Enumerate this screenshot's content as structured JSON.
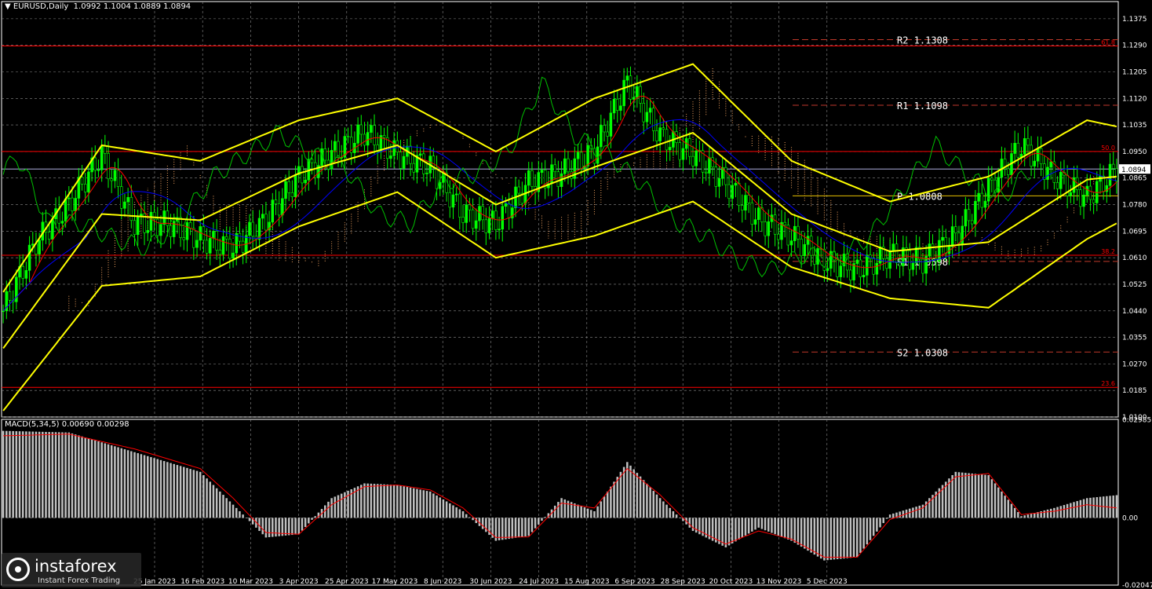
{
  "header": {
    "symbol": "EURUSD,Daily",
    "ohlc": "1.0992 1.1004 1.0889 1.0894"
  },
  "macd_header": {
    "label": "MACD(5,34,5)",
    "values": "0.00690 0.00298"
  },
  "logo": {
    "name": "instaforex",
    "tagline": "Instant Forex Trading"
  },
  "colors": {
    "background": "#000000",
    "grid": "#8c8c8c",
    "bull_candle": "#00ff00",
    "bear_candle": "#000000",
    "bollinger": "#ffff00",
    "tenkan": "#ff0000",
    "kijun": "#0000ff",
    "chikou": "#00c000",
    "kumo": "#f4a460",
    "pivot_lines": "#c0392b",
    "fib_lines": "#ff0000",
    "macd_hist": "#c0c0c0",
    "macd_signal": "#ff0000",
    "current_price": "#c8c8ff"
  },
  "chart_data": [
    {
      "type": "candlestick",
      "title": "EURUSD,Daily",
      "ylim": [
        1.01,
        1.143
      ],
      "y_ticks": [
        "1.1375",
        "1.1290",
        "1.1205",
        "1.1120",
        "1.1035",
        "1.0950",
        "1.0865",
        "1.0780",
        "1.0695",
        "1.0610",
        "1.0525",
        "1.0440",
        "1.0355",
        "1.0270",
        "1.0185",
        "1.0100"
      ],
      "x_ticks": [
        "25 Jan 2023",
        "16 Feb 2023",
        "10 Mar 2023",
        "3 Apr 2023",
        "25 Apr 2023",
        "17 May 2023",
        "8 Jun 2023",
        "30 Jun 2023",
        "24 Jul 2023",
        "15 Aug 2023",
        "6 Sep 2023",
        "28 Sep 2023",
        "20 Oct 2023",
        "13 Nov 2023",
        "5 Dec 2023"
      ],
      "current_price": "1.0894",
      "pivot_levels": [
        {
          "label": "R2",
          "value": "1.1308"
        },
        {
          "label": "R1",
          "value": "1.1098"
        },
        {
          "label": "P",
          "value": "1.0808"
        },
        {
          "label": "S1",
          "value": "1.0598"
        },
        {
          "label": "S2",
          "value": "1.0308"
        }
      ],
      "fib_levels": [
        {
          "label": "61.8",
          "value": 1.1288
        },
        {
          "label": "50.0",
          "value": 1.095
        },
        {
          "label": "38.2",
          "value": 1.0618
        },
        {
          "label": "23.6",
          "value": 1.0195
        }
      ],
      "series": [
        {
          "name": "close_path",
          "x": [
            0,
            10,
            20,
            30,
            40,
            50,
            60,
            70,
            80,
            90,
            100,
            110,
            120,
            130,
            140,
            150,
            160,
            170,
            180,
            190,
            200,
            210,
            220,
            230,
            240,
            250,
            260,
            270,
            280,
            290,
            300,
            310,
            320,
            330,
            339
          ],
          "values": [
            1.044,
            1.066,
            1.078,
            1.094,
            1.072,
            1.072,
            1.067,
            1.064,
            1.073,
            1.087,
            1.094,
            1.101,
            1.094,
            1.09,
            1.075,
            1.072,
            1.085,
            1.088,
            1.095,
            1.117,
            1.1,
            1.094,
            1.085,
            1.073,
            1.068,
            1.06,
            1.057,
            1.062,
            1.06,
            1.068,
            1.083,
            1.097,
            1.087,
            1.08,
            1.0894
          ]
        },
        {
          "name": "bollinger_middle",
          "x": [
            0,
            30,
            60,
            90,
            120,
            150,
            180,
            210,
            240,
            270,
            300,
            330,
            339
          ],
          "values": [
            1.032,
            1.075,
            1.073,
            1.088,
            1.097,
            1.078,
            1.09,
            1.101,
            1.075,
            1.063,
            1.066,
            1.086,
            1.087
          ]
        },
        {
          "name": "bollinger_upper",
          "x": [
            0,
            30,
            60,
            90,
            120,
            150,
            180,
            210,
            240,
            270,
            300,
            330,
            339
          ],
          "values": [
            1.05,
            1.097,
            1.092,
            1.105,
            1.112,
            1.095,
            1.112,
            1.123,
            1.092,
            1.079,
            1.087,
            1.105,
            1.103
          ]
        },
        {
          "name": "bollinger_lower",
          "x": [
            0,
            30,
            60,
            90,
            120,
            150,
            180,
            210,
            240,
            270,
            300,
            330,
            339
          ],
          "values": [
            1.012,
            1.052,
            1.055,
            1.071,
            1.082,
            1.061,
            1.068,
            1.079,
            1.058,
            1.048,
            1.045,
            1.067,
            1.072
          ]
        }
      ]
    },
    {
      "type": "bar",
      "title": "MACD(5,34,5)",
      "ylim": [
        -0.0205,
        0.03
      ],
      "y_ticks": [
        "0.02985",
        "0.00",
        "-0.02047"
      ],
      "series": [
        {
          "name": "histogram",
          "x": [
            0,
            20,
            40,
            60,
            70,
            80,
            90,
            100,
            110,
            120,
            130,
            140,
            150,
            160,
            170,
            180,
            190,
            200,
            210,
            220,
            230,
            240,
            250,
            260,
            270,
            280,
            290,
            300,
            310,
            320,
            330,
            339
          ],
          "values": [
            0.0265,
            0.026,
            0.02,
            0.014,
            0.004,
            -0.006,
            -0.005,
            0.006,
            0.0105,
            0.01,
            0.008,
            0.002,
            -0.007,
            -0.0055,
            0.006,
            0.002,
            0.017,
            0.006,
            -0.004,
            -0.009,
            -0.003,
            -0.007,
            -0.013,
            -0.012,
            0.001,
            0.004,
            0.014,
            0.013,
            0.0005,
            0.003,
            0.006,
            0.0069
          ]
        },
        {
          "name": "signal",
          "x": [
            0,
            20,
            40,
            60,
            70,
            80,
            90,
            100,
            110,
            120,
            130,
            140,
            150,
            160,
            170,
            180,
            190,
            200,
            210,
            220,
            230,
            240,
            250,
            260,
            270,
            280,
            290,
            300,
            310,
            320,
            330,
            339
          ],
          "values": [
            0.025,
            0.0255,
            0.021,
            0.015,
            0.006,
            -0.0045,
            -0.005,
            0.004,
            0.0095,
            0.01,
            0.0085,
            0.003,
            -0.006,
            -0.0058,
            0.0045,
            0.003,
            0.015,
            0.007,
            -0.003,
            -0.008,
            -0.004,
            -0.0065,
            -0.012,
            -0.012,
            -0.0005,
            0.003,
            0.0125,
            0.0135,
            0.001,
            0.002,
            0.004,
            0.003
          ]
        }
      ]
    }
  ]
}
